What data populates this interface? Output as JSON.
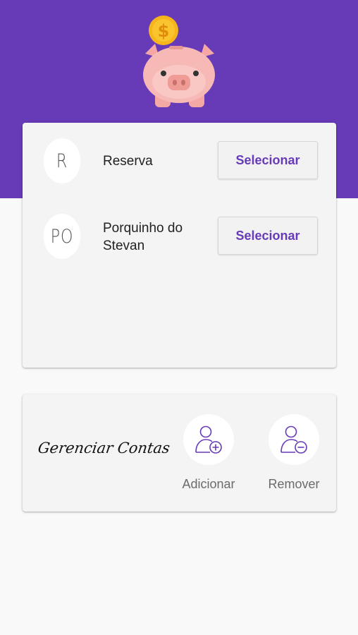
{
  "app": {
    "logo_icon": "piggy-bank-icon",
    "colors": {
      "primary": "#673ab7",
      "background": "#f9f9f9",
      "card": "#f4f4f4"
    }
  },
  "accounts": [
    {
      "initials": "R",
      "name": "Reserva",
      "button_label": "Selecionar"
    },
    {
      "initials": "PO",
      "name": "Porquinho do Stevan",
      "button_label": "Selecionar"
    }
  ],
  "manage": {
    "title": "Gerenciar Contas",
    "add": {
      "label": "Adicionar",
      "icon": "add-user-icon"
    },
    "remove": {
      "label": "Remover",
      "icon": "remove-user-icon"
    }
  }
}
